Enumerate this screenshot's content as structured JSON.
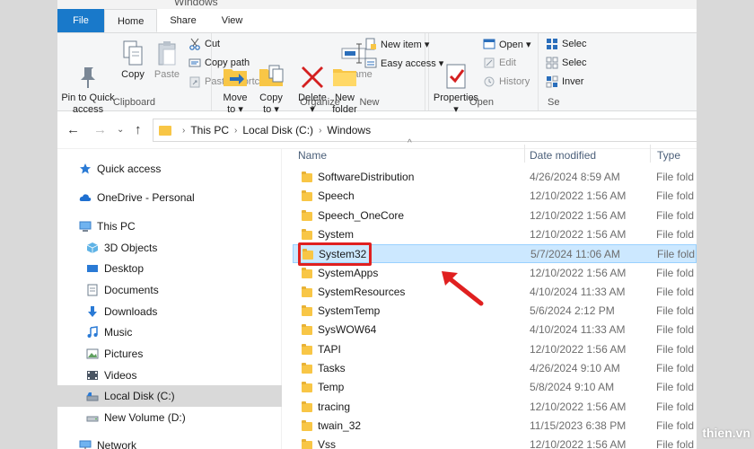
{
  "window": {
    "title": "Windows"
  },
  "tabs": [
    "File",
    "Home",
    "Share",
    "View"
  ],
  "ribbon": {
    "clipboard": {
      "pin_label": "Pin to Quick\naccess",
      "copy_label": "Copy",
      "paste_label": "Paste",
      "cut_label": "Cut",
      "copy_path_label": "Copy path",
      "paste_shortcut_label": "Paste shortcut",
      "group_label": "Clipboard"
    },
    "organize": {
      "move_to_label": "Move\nto ▾",
      "copy_to_label": "Copy\nto ▾",
      "delete_label": "Delete\n▾",
      "rename_label": "Rename",
      "group_label": "Organize"
    },
    "new": {
      "new_folder_label": "New\nfolder",
      "new_item_label": "New item ▾",
      "easy_access_label": "Easy access ▾",
      "group_label": "New"
    },
    "open": {
      "properties_label": "Properties\n▾",
      "open_label": "Open ▾",
      "edit_label": "Edit",
      "history_label": "History",
      "group_label": "Open"
    },
    "select": {
      "select_all_label": "Selec",
      "select_none_label": "Selec",
      "invert_label": "Inver",
      "group_label": "Se"
    }
  },
  "address": {
    "crumbs": [
      "This PC",
      "Local Disk (C:)",
      "Windows"
    ]
  },
  "nav": {
    "items": [
      {
        "label": "Quick access",
        "icon": "star-icon"
      },
      {
        "label": "OneDrive - Personal",
        "icon": "cloud-icon"
      },
      {
        "label": "This PC",
        "icon": "pc-icon"
      },
      {
        "label": "3D Objects",
        "icon": "cube-icon"
      },
      {
        "label": "Desktop",
        "icon": "desktop-icon"
      },
      {
        "label": "Documents",
        "icon": "document-icon"
      },
      {
        "label": "Downloads",
        "icon": "download-icon"
      },
      {
        "label": "Music",
        "icon": "music-icon"
      },
      {
        "label": "Pictures",
        "icon": "picture-icon"
      },
      {
        "label": "Videos",
        "icon": "video-icon"
      },
      {
        "label": "Local Disk (C:)",
        "icon": "drive-icon"
      },
      {
        "label": "New Volume (D:)",
        "icon": "drive-icon"
      },
      {
        "label": "Network",
        "icon": "network-icon"
      }
    ]
  },
  "list": {
    "headers": {
      "name": "Name",
      "date": "Date modified",
      "type": "Type"
    },
    "rows": [
      {
        "name": "SoftwareDistribution",
        "date": "4/26/2024 8:59 AM",
        "type": "File fold"
      },
      {
        "name": "Speech",
        "date": "12/10/2022 1:56 AM",
        "type": "File fold"
      },
      {
        "name": "Speech_OneCore",
        "date": "12/10/2022 1:56 AM",
        "type": "File fold"
      },
      {
        "name": "System",
        "date": "12/10/2022 1:56 AM",
        "type": "File fold"
      },
      {
        "name": "System32",
        "date": "5/7/2024 11:06 AM",
        "type": "File fold"
      },
      {
        "name": "SystemApps",
        "date": "12/10/2022 1:56 AM",
        "type": "File fold"
      },
      {
        "name": "SystemResources",
        "date": "4/10/2024 11:33 AM",
        "type": "File fold"
      },
      {
        "name": "SystemTemp",
        "date": "5/6/2024 2:12 PM",
        "type": "File fold"
      },
      {
        "name": "SysWOW64",
        "date": "4/10/2024 11:33 AM",
        "type": "File fold"
      },
      {
        "name": "TAPI",
        "date": "12/10/2022 1:56 AM",
        "type": "File fold"
      },
      {
        "name": "Tasks",
        "date": "4/26/2024 9:10 AM",
        "type": "File fold"
      },
      {
        "name": "Temp",
        "date": "5/8/2024 9:10 AM",
        "type": "File fold"
      },
      {
        "name": "tracing",
        "date": "12/10/2022 1:56 AM",
        "type": "File fold"
      },
      {
        "name": "twain_32",
        "date": "11/15/2023 6:38 PM",
        "type": "File fold"
      },
      {
        "name": "Vss",
        "date": "12/10/2022 1:56 AM",
        "type": "File fold"
      }
    ]
  },
  "watermark": "thien.vn"
}
